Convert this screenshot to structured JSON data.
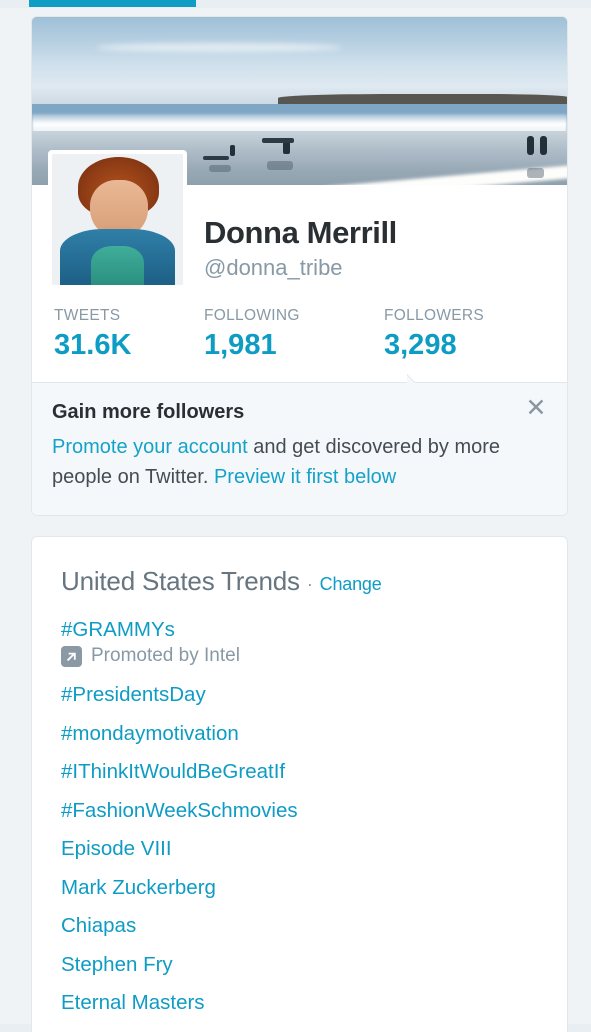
{
  "colors": {
    "accent": "#0e9cc4",
    "link": "#15a2c9",
    "muted": "#8899a6",
    "text": "#292f33",
    "page_bg": "#eff3f5",
    "card_bg": "#ffffff",
    "promo_bg": "#f5f8fa"
  },
  "profile": {
    "full_name": "Donna Merrill",
    "handle": "@donna_tribe",
    "banner_alt": "beach-banner-photo",
    "avatar_alt": "profile-avatar-photo",
    "stats": [
      {
        "label": "TWEETS",
        "value": "31.6K"
      },
      {
        "label": "FOLLOWING",
        "value": "1,981"
      },
      {
        "label": "FOLLOWERS",
        "value": "3,298"
      }
    ]
  },
  "promo": {
    "title": "Gain more followers",
    "link1": "Promote your account",
    "mid_text": " and get discovered by more people on Twitter. ",
    "link2": "Preview it first below",
    "close_icon": "✕"
  },
  "trends": {
    "title": "United States Trends",
    "separator": "·",
    "change_label": "Change",
    "promoted_icon": "external-link-arrow",
    "items": [
      {
        "label": "#GRAMMYs",
        "promoted_by": "Promoted by Intel"
      },
      {
        "label": "#PresidentsDay"
      },
      {
        "label": "#mondaymotivation"
      },
      {
        "label": "#IThinkItWouldBeGreatIf"
      },
      {
        "label": "#FashionWeekSchmovies"
      },
      {
        "label": "Episode VIII"
      },
      {
        "label": "Mark Zuckerberg"
      },
      {
        "label": "Chiapas"
      },
      {
        "label": "Stephen Fry"
      },
      {
        "label": "Eternal Masters"
      }
    ]
  }
}
